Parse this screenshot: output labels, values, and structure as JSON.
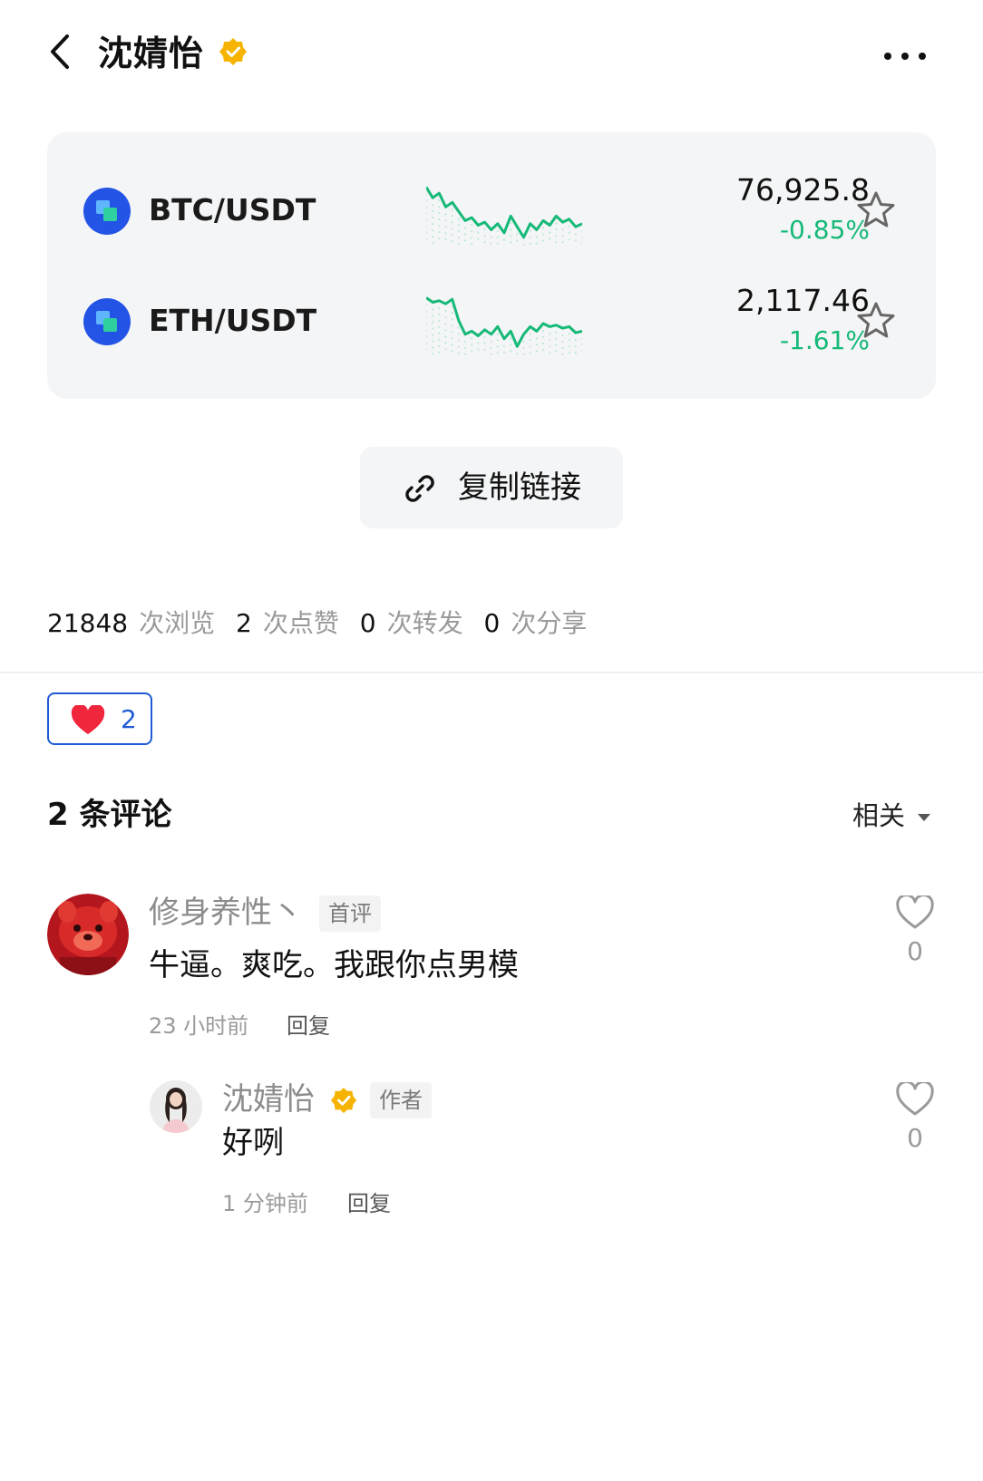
{
  "header": {
    "title": "沈婧怡",
    "verified_icon": "verified-badge-icon",
    "more_icon": "more-icon"
  },
  "market": {
    "pairs": [
      {
        "name": "BTC/USDT",
        "price": "76,925.8",
        "change": "-0.85%",
        "trend": [
          0.78,
          0.64,
          0.7,
          0.52,
          0.58,
          0.46,
          0.34,
          0.38,
          0.28,
          0.32,
          0.22,
          0.3,
          0.18,
          0.4,
          0.26,
          0.12,
          0.3,
          0.22,
          0.34,
          0.28,
          0.4,
          0.32,
          0.36,
          0.26,
          0.3
        ]
      },
      {
        "name": "ETH/USDT",
        "price": "2,117.46",
        "change": "-1.61%",
        "trend": [
          0.78,
          0.72,
          0.74,
          0.7,
          0.76,
          0.48,
          0.3,
          0.34,
          0.28,
          0.36,
          0.3,
          0.4,
          0.24,
          0.34,
          0.14,
          0.3,
          0.4,
          0.34,
          0.44,
          0.4,
          0.42,
          0.38,
          0.4,
          0.32,
          0.34
        ]
      }
    ],
    "accent_color": "#16b978"
  },
  "copy_link": {
    "label": "复制链接",
    "icon": "link-icon"
  },
  "stats": [
    {
      "value": "21848",
      "label": "次浏览"
    },
    {
      "value": "2",
      "label": "次点赞"
    },
    {
      "value": "0",
      "label": "次转发"
    },
    {
      "value": "0",
      "label": "次分享"
    }
  ],
  "reaction": {
    "icon": "heart-icon",
    "count": "2"
  },
  "comments": {
    "title": "2 条评论",
    "sort_label": "相关",
    "items": [
      {
        "user": "修身养性丶",
        "tag": "首评",
        "text": "牛逼。爽吃。我跟你点男模",
        "time": "23 小时前",
        "reply_label": "回复",
        "likes": "0"
      },
      {
        "user": "沈婧怡",
        "tag": "作者",
        "text": "好咧",
        "time": "1 分钟前",
        "reply_label": "回复",
        "likes": "0"
      }
    ]
  }
}
